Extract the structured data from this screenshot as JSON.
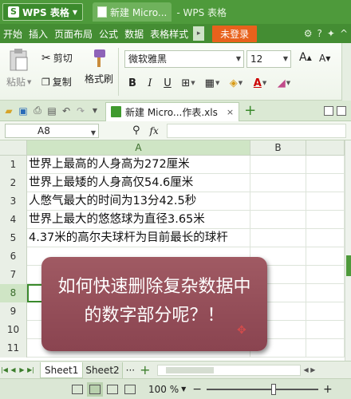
{
  "titlebar": {
    "app_name": "WPS 表格",
    "logo_letter": "S",
    "doc_tab": "新建 Micro...",
    "title": "- WPS 表格"
  },
  "menu": {
    "items": [
      "开始",
      "插入",
      "页面布局",
      "公式",
      "数据",
      "表格样式"
    ],
    "more": "▸",
    "login": "未登录"
  },
  "ribbon": {
    "paste": "粘贴",
    "cut": "剪切",
    "copy": "复制",
    "format_painter": "格式刷",
    "font_name": "微软雅黑",
    "font_size": "12",
    "grow": "A",
    "shrink": "A",
    "bold": "B",
    "italic": "I",
    "underline": "U",
    "font_color_letter": "A"
  },
  "tabbar": {
    "file_tab": "新建 Micro...作表.xls",
    "close": "×",
    "new": "+"
  },
  "formulabar": {
    "cell_ref": "A8",
    "fx": "fx"
  },
  "grid": {
    "columns": [
      "A",
      "B"
    ],
    "rows": [
      {
        "num": "1",
        "a": "世界上最高的人身高为272厘米"
      },
      {
        "num": "2",
        "a": "世界上最矮的人身高仅54.6厘米"
      },
      {
        "num": "3",
        "a": "人憋气最大的时间为13分42.5秒"
      },
      {
        "num": "4",
        "a": "世界上最大的悠悠球为直径3.65米"
      },
      {
        "num": "5",
        "a": "4.37米的高尔夫球杆为目前最长的球杆"
      },
      {
        "num": "6",
        "a": ""
      },
      {
        "num": "7",
        "a": ""
      },
      {
        "num": "8",
        "a": ""
      },
      {
        "num": "9",
        "a": ""
      },
      {
        "num": "10",
        "a": ""
      },
      {
        "num": "11",
        "a": ""
      }
    ],
    "selected_row": "8"
  },
  "caption": {
    "line1": "如何快速删除复杂数据中",
    "line2": "的数字部分呢？！"
  },
  "sheets": {
    "tabs": [
      "Sheet1",
      "Sheet2"
    ],
    "more": "···",
    "add": "+"
  },
  "status": {
    "zoom": "100 %",
    "zoom_level": 0.6,
    "minus": "−",
    "plus": "+"
  },
  "colors": {
    "title_green": "#4e9a3b",
    "login_orange": "#e8621c",
    "caption_red": "#8a4450"
  }
}
